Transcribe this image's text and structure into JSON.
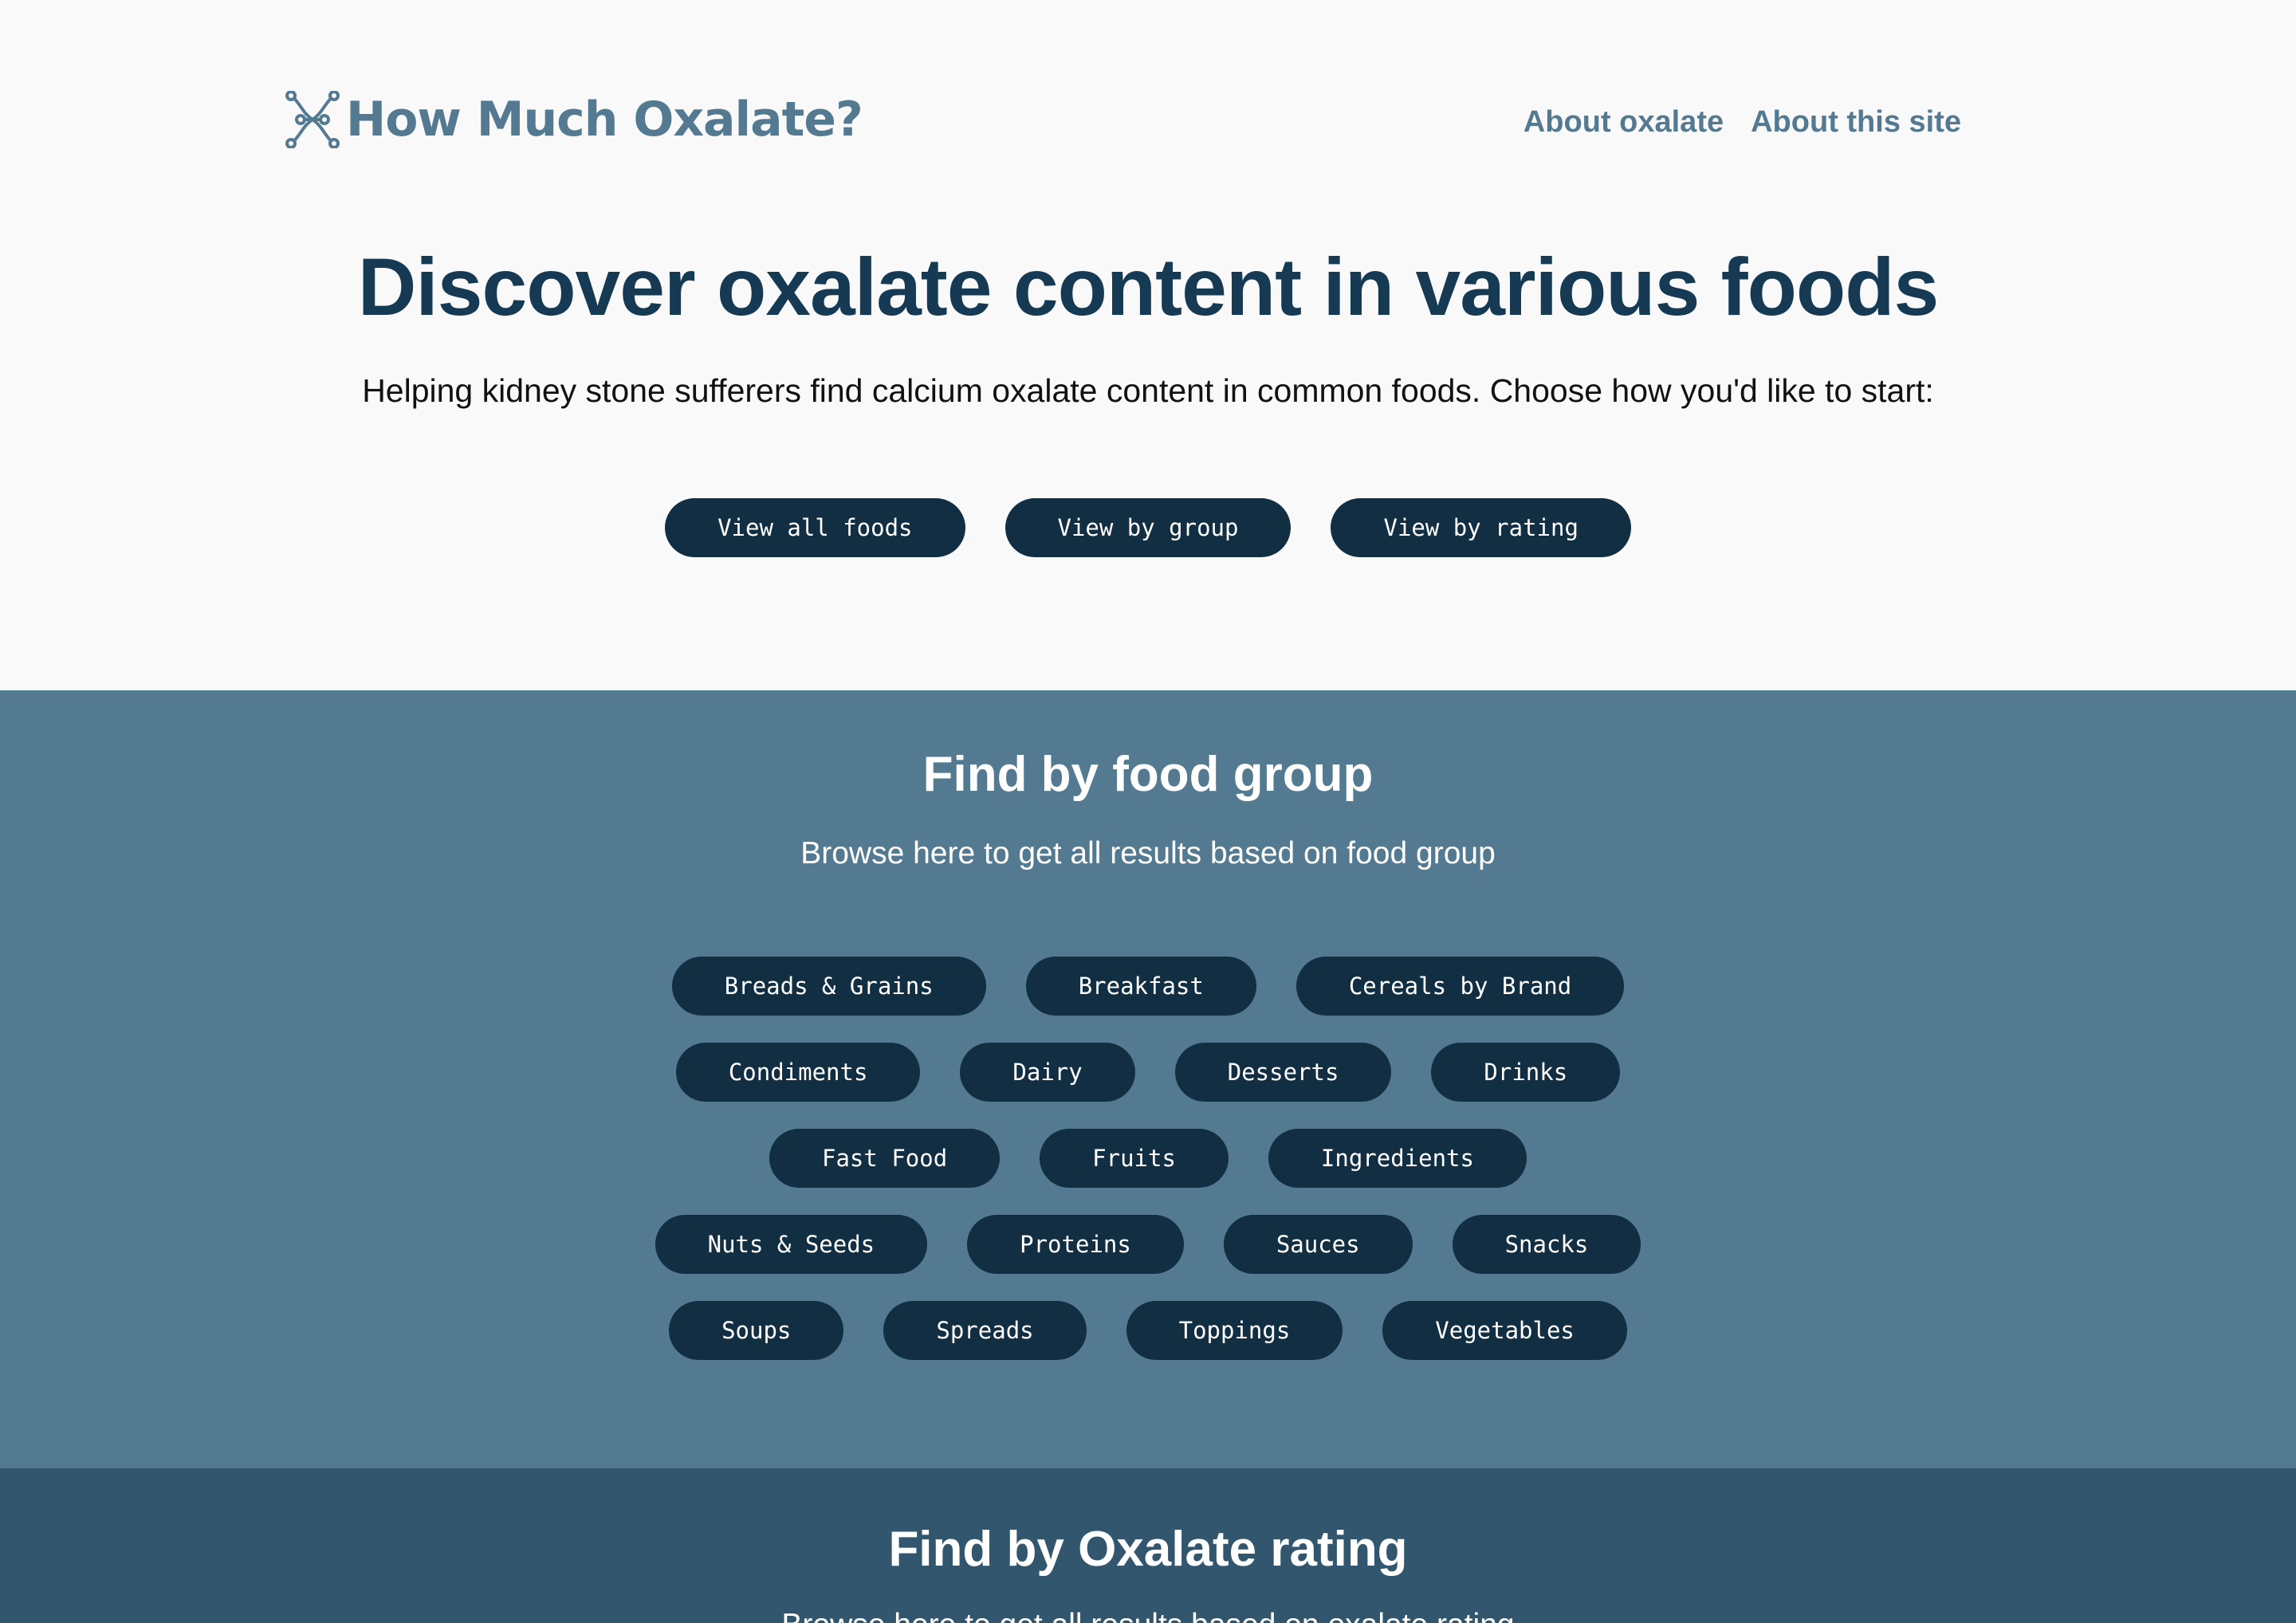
{
  "header": {
    "site_name": "How Much Oxalate?",
    "logo_icon": "molecule-icon",
    "nav": [
      {
        "label": "About oxalate"
      },
      {
        "label": "About this site"
      }
    ]
  },
  "hero": {
    "title": "Discover oxalate content in various foods",
    "subtitle": "Helping kidney stone sufferers find calcium oxalate content in common foods. Choose how you'd like to start:",
    "buttons": [
      {
        "label": "View all foods"
      },
      {
        "label": "View by group"
      },
      {
        "label": "View by rating"
      }
    ]
  },
  "group_section": {
    "title": "Find by food group",
    "subtitle": "Browse here to get all results based on food group",
    "rows": [
      [
        "Breads & Grains",
        "Breakfast",
        "Cereals by Brand"
      ],
      [
        "Condiments",
        "Dairy",
        "Desserts",
        "Drinks"
      ],
      [
        "Fast Food",
        "Fruits",
        "Ingredients"
      ],
      [
        "Nuts & Seeds",
        "Proteins",
        "Sauces",
        "Snacks"
      ],
      [
        "Soups",
        "Spreads",
        "Toppings",
        "Vegetables"
      ]
    ]
  },
  "rating_section": {
    "title": "Find by Oxalate rating",
    "subtitle": "Browse here to get all results based on oxalate rating"
  },
  "colors": {
    "page_background": "#f9f9fa",
    "brand": "#547a91",
    "heading": "#163a53",
    "button": "#112e43",
    "group_section_bg": "#537a90",
    "rating_section_bg": "#32566d"
  }
}
